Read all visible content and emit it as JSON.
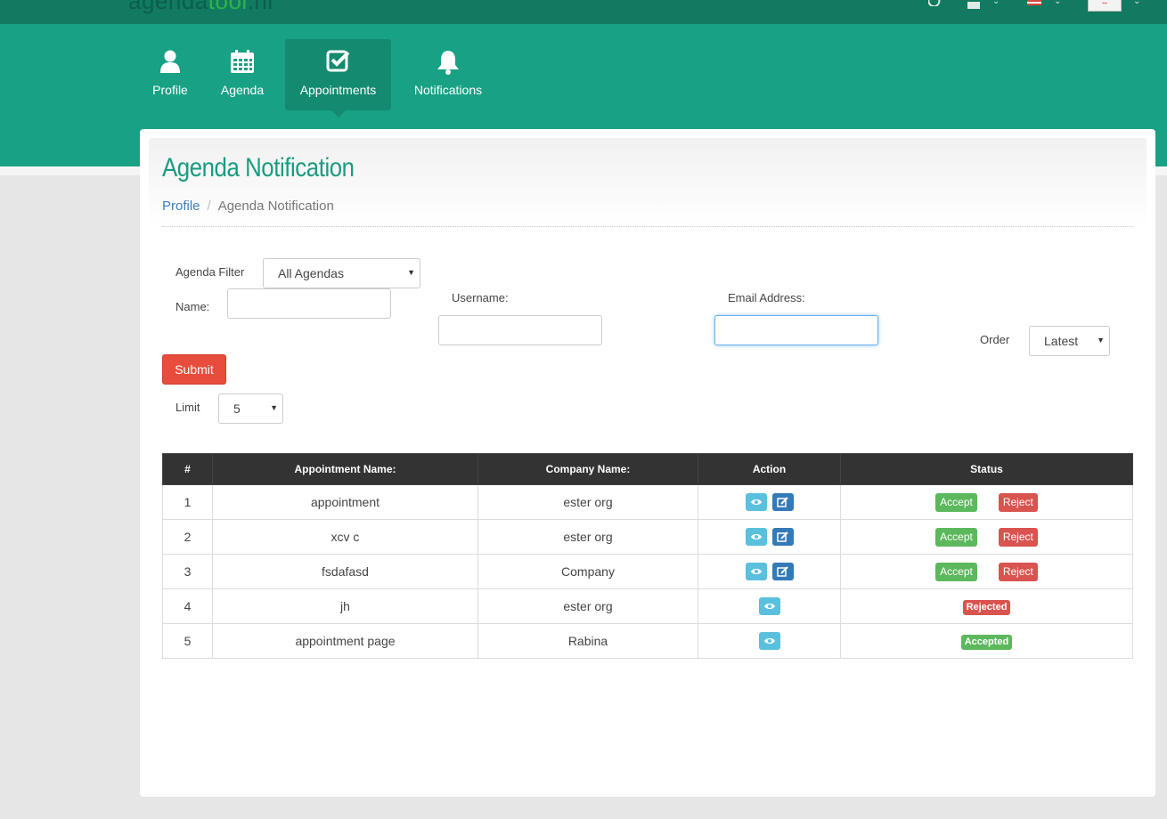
{
  "brand": {
    "logo_main": "agenda",
    "logo_accent": "tool",
    "logo_tail": ".nl",
    "brand_color": "#18a185"
  },
  "nav": {
    "items": [
      {
        "label": "Profile",
        "icon": "user-icon",
        "active": false
      },
      {
        "label": "Agenda",
        "icon": "calendar-icon",
        "active": false
      },
      {
        "label": "Appointments",
        "icon": "check-square-icon",
        "active": true
      },
      {
        "label": "Notifications",
        "icon": "bell-icon",
        "active": false
      }
    ]
  },
  "page": {
    "title": "Agenda Notification",
    "breadcrumb": {
      "link": "Profile",
      "current": "Agenda Notification"
    }
  },
  "filters": {
    "agenda_filter_label": "Agenda Filter",
    "agenda_filter_value": "All Agendas",
    "name_label": "Name:",
    "name_value": "",
    "username_label": "Username:",
    "username_value": "",
    "email_label": "Email Address:",
    "email_value": "",
    "order_label": "Order",
    "order_value": "Latest",
    "submit_label": "Submit",
    "limit_label": "Limit",
    "limit_value": "5"
  },
  "table": {
    "headers": [
      "#",
      "Appointment Name:",
      "Company Name:",
      "Action",
      "Status"
    ],
    "accept_label": "Accept",
    "reject_label": "Reject",
    "rows": [
      {
        "num": "1",
        "name": "appointment",
        "company": "ester org",
        "editable": true,
        "status": "pending",
        "status_label": ""
      },
      {
        "num": "2",
        "name": "xcv c",
        "company": "ester org",
        "editable": true,
        "status": "pending",
        "status_label": ""
      },
      {
        "num": "3",
        "name": "fsdafasd",
        "company": "Company",
        "editable": true,
        "status": "pending",
        "status_label": ""
      },
      {
        "num": "4",
        "name": "jh",
        "company": "ester org",
        "editable": false,
        "status": "rejected",
        "status_label": "Rejected"
      },
      {
        "num": "5",
        "name": "appointment page",
        "company": "Rabina",
        "editable": false,
        "status": "accepted",
        "status_label": "Accepted"
      }
    ]
  }
}
